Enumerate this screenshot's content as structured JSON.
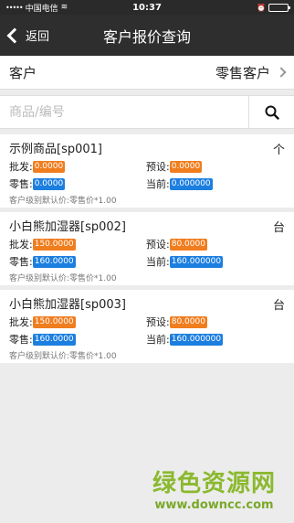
{
  "statusbar": {
    "signal": "•••••",
    "carrier": "中国电信",
    "wifi": "≋",
    "time": "10:37",
    "alarm": "⏰",
    "battery_level": 0.9
  },
  "navbar": {
    "back_label": "返回",
    "title": "客户报价查询"
  },
  "customer": {
    "label": "客户",
    "value": "零售客户"
  },
  "search": {
    "placeholder": "商品/编号",
    "value": ""
  },
  "items": [
    {
      "name": "示例商品[sp001]",
      "unit": "个",
      "wholesale_label": "批发:",
      "wholesale": "0.0000",
      "preset_label": "预设:",
      "preset": "0.0000",
      "retail_label": "零售:",
      "retail": "0.0000",
      "current_label": "当前:",
      "current": "0.000000",
      "note": "客户级别默认价:零售价*1.00"
    },
    {
      "name": "小白熊加湿器[sp002]",
      "unit": "台",
      "wholesale_label": "批发:",
      "wholesale": "150.0000",
      "preset_label": "预设:",
      "preset": "80.0000",
      "retail_label": "零售:",
      "retail": "160.0000",
      "current_label": "当前:",
      "current": "160.000000",
      "note": "客户级别默认价:零售价*1.00"
    },
    {
      "name": "小白熊加湿器[sp003]",
      "unit": "台",
      "wholesale_label": "批发:",
      "wholesale": "150.0000",
      "preset_label": "预设:",
      "preset": "80.0000",
      "retail_label": "零售:",
      "retail": "160.0000",
      "current_label": "当前:",
      "current": "160.000000",
      "note": "客户级别默认价:零售价*1.00"
    }
  ],
  "watermark": {
    "title": "绿色资源网",
    "url": "www.downcc.com"
  },
  "colors": {
    "orange": "#f07d1e",
    "blue": "#1c7fe0",
    "navbar": "#2e2e2e"
  }
}
